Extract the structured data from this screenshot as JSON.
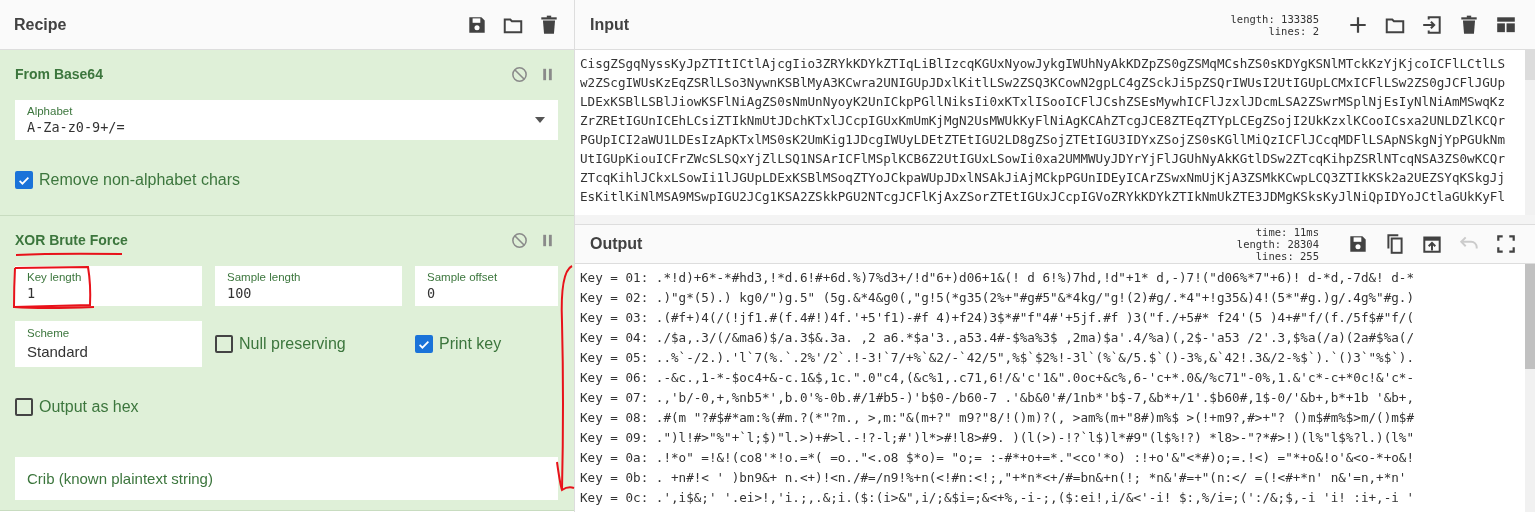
{
  "recipe": {
    "title": "Recipe",
    "toolbar": [
      {
        "kind": "save"
      },
      {
        "kind": "folder"
      },
      {
        "kind": "trash"
      }
    ],
    "operations": [
      {
        "name": "From Base64",
        "rows": [
          [
            {
              "kind": "dropdown",
              "label": "Alphabet",
              "value": "A-Za-z0-9+/="
            }
          ],
          [
            {
              "kind": "checkbox",
              "label": "Remove non-alphabet chars",
              "checked": true
            }
          ]
        ]
      },
      {
        "name": "XOR Brute Force",
        "rows": [
          [
            {
              "kind": "number",
              "label": "Key length",
              "value": "1"
            },
            {
              "kind": "number",
              "label": "Sample length",
              "value": "100"
            },
            {
              "kind": "number",
              "label": "Sample offset",
              "value": "0"
            }
          ],
          [
            {
              "kind": "select",
              "label": "Scheme",
              "value": "Standard"
            },
            {
              "kind": "checkbox",
              "label": "Null preserving",
              "checked": false
            },
            {
              "kind": "checkbox",
              "label": "Print key",
              "checked": true
            }
          ],
          [
            {
              "kind": "checkbox",
              "label": "Output as hex",
              "checked": false
            }
          ],
          [
            {
              "kind": "text",
              "placeholder": "Crib (known plaintext string)"
            }
          ]
        ]
      }
    ]
  },
  "input": {
    "title": "Input",
    "stats": [
      {
        "label": "length:",
        "value": "133385"
      },
      {
        "label": "lines:",
        "value": "2"
      }
    ],
    "toolbar": [
      {
        "kind": "plus",
        "disabled": false
      },
      {
        "kind": "folder",
        "disabled": false
      },
      {
        "kind": "import",
        "disabled": false
      },
      {
        "kind": "trash",
        "disabled": false
      },
      {
        "kind": "layout",
        "disabled": false
      }
    ],
    "lines": [
      "CisgZSgqNyssKyJpZTItICtlAjcgIio3ZRYkKDYkZTIqLiBlIzcqKGUxNyowJykgIWUhNyAkKDZpZS0gZSMqMCshZS0sKDYgKSNlMTckKzYjKjcoICFlLCtlLS",
      "w2ZScgIWUsKzEqZSRlLSo3NywnKSBlMyA3KCwra2UNIGUpJDxlKitlLSw2ZSQ3KCowN2gpLC4gZSckJi5pZSQrIWUsI2UtIGUpLCMxICFlLSw2ZS0gJCFlJGUp",
      "LDExKSBlLSBlJiowKSFlNiAgZS0sNmUnNyoyK2UnICkpPGllNiksIi0xKTxlISooICFlJCshZSEsMywhICFlJzxlJDcmLSA2ZSwrMSplNjEsIyNlNiAmMSwqKz",
      "ZrZREtIGUnICEhLCsiZTIkNmUtJDchKTxlJCcpIGUxKmUmKjMgN2UsMWUkKyFlNiAgKCAhZTcgJCE8ZTEqZTYpLCEgZSojI2UkKzxlKCooICsxa2UNLDZlKCQr",
      "PGUpICI2aWU1LDEsIzApKTxlMS0sK2UmKig1JDcgIWUyLDEtZTEtIGU2LD8gZSojZTEtIGU3IDYxZSojZS0sKGllMiQzICFlJCcqMDFlLSApNSkgNjYpPGUkNm",
      "UtIGUpKiouICFrZWcSLSQxYjZlLSQ1NSArICFlMSplKCB6Z2UtIGUxLSowIi0xa2UMMWUyJDYrYjFlJGUhNyAkKGtlDSw2ZTcqKihpZSRlNTcqNSA3ZS0wKCQr",
      "ZTcqKihlJCkxLSowIi1lJGUpLDExKSBlMSoqZTYoJCkpaWUpJDxlNSAkJiAjMCkpPGUnIDEyICArZSwxNmUjKjA3ZSMkKCwpLCQ3ZTIkKSk2a2UEZSYqKSkgJj",
      "EsKitlKiNlMSA9MSwpIGU2JCg1KSA2ZSkkPGU2NTcgJCFlKjAxZSorZTEtIGUxJCcpIGVoZRYkKDYkZTIkNmUkZTE3JDMgKSksKyJlNiQpIDYoJCtlaGUkKyFl"
    ]
  },
  "output": {
    "title": "Output",
    "stats": [
      {
        "label": "time:",
        "value": "11ms"
      },
      {
        "label": "length:",
        "value": "28304"
      },
      {
        "label": "lines:",
        "value": "255"
      }
    ],
    "toolbar": [
      {
        "kind": "save",
        "disabled": false
      },
      {
        "kind": "copy",
        "disabled": false
      },
      {
        "kind": "export",
        "disabled": false
      },
      {
        "kind": "undo",
        "disabled": true
      },
      {
        "kind": "fullscreen",
        "disabled": false
      }
    ],
    "lines": [
      "Key = 01: .*!d)+6*-*#hd3,!*d.6!#+6d.%)7%d3+/!d\"6+)d06+1&(! d 6!%)7hd,!d\"+1* d,-)7!(\"d06%*7\"+6)! d-*d,-7d&! d-*",
      "Key = 02: .)\"g*(5).) kg0/\")g.5\" (5g.&*4&g0(,\"g!5(*g35(2%+\"#g#5\"&*4kg/\"g!(2)#g/.*4\"+!g35&)4!(5*\"#g.)g/.4g%\"#g.)",
      "Key = 03: .(#f+)4(/(!jf1.#(f.4#!)4f.'+5'f1)-#f 4)+f24)3$*#\"f\"4#'+5jf.#f )3(\"f./+5#* f24'(5 )4+#\"f/(f./5f$#\"f/(",
      "Key = 04: ./$a,.3/(/&ma6)$/a.3$&.3a. ,2 a6.*$a'3.,a53.4#-$%a%3$ ,2ma)$a'.4/%a)(,2$-'a53 /2'.3,$%a(/a)(2a#$%a(/",
      "Key = 05: ..%`-/2.).'l`7(%.`.2%'/2`.!-3!`7/+%`&2/-`42/5\",%$`$2%!-3l`(%`&/5.$`()-3%,&`42!.3&/2-%$`).`()3`\"%$`).",
      "Key = 06: .-&c.,1-*-$oc4+&-c.1&$,1c.\".0\"c4,(&c%1,.c71,6!/&'c'1&\".0oc+&c%,6-'c+*.0&/%c71\"-0%,1.&'c*-c+*0c!&'c*-",
      "Key = 07: .,'b/-0,+,%nb5*',b.0'%-0b.#/1#b5-)'b$0-/b60-7 .'&b&0'#/1nb*'b$-7,&b*+/1'.$b60#,1$-0/'&b+,b*+1b '&b+,",
      "Key = 08: .#(m \"?#$#*am:%(#m.?(*\"?m., >,m:\"&(m+?\" m9?\"8/!()m)?(, >am%(m+\"8#)m%$ >(!+m9?,#>+\"? ()m$#m%$>m/()m$#",
      "Key = 09: .\")l!#>\"%\"+`l;$)\"l.>)+#>l.-!?-l;#')l*>#!l8>#9. )(l(>)-!?`l$)l*#9\"(l$%!?) *l8>-\"?*#>!)(l%\"l$%?l.)(l%\"",
      "Key = 0a: .!*o\" =!&!(co8'*!o.=*( =o..\"<.o8 $*o)= \"o;= :-#*+o+=*.\"<co'*o) :!+o'&\"<*#)o;=.!<) =\"*+o&!o'&<o-*+o&!",
      "Key = 0b: . +n#!< ' )bn9&+ n.<+)!<n./#=/n9!%+n(<!#n:<!;,\"+*n*<+/#=bn&+n(!; *n&'#=+\"(n:</ =(!<#+*n' n&'=n,+*n'",
      "Key = 0c: .',i$&;' '.ei>!,'i.;,.&;i.($:(i>&\",i/;&$i=;&<+%,-i-;,($:ei!,i/&<'-i! $:,%/i=;(':/&;$,-i 'i! :i+,-i '"
    ]
  },
  "annotations": [
    {
      "kind": "underline"
    },
    {
      "kind": "box"
    },
    {
      "kind": "arrow"
    }
  ]
}
